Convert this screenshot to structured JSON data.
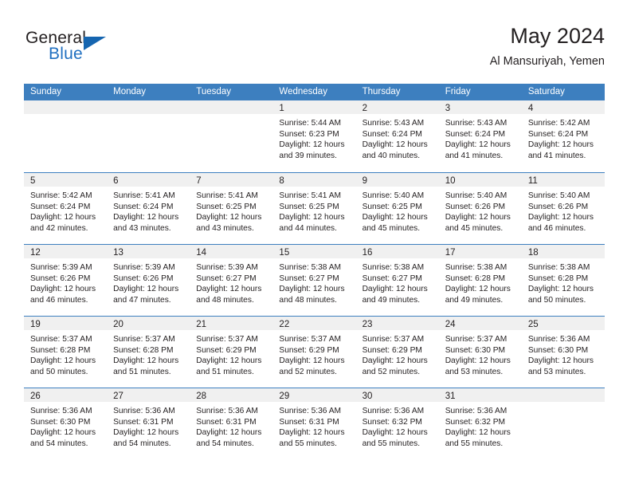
{
  "brand": {
    "name_top": "General",
    "name_bottom": "Blue",
    "accent_color": "#1565b0",
    "triangle_icon": "triangle-icon"
  },
  "header": {
    "title": "May 2024",
    "subtitle": "Al Mansuriyah, Yemen"
  },
  "theme": {
    "header_blue": "#3d7fbf",
    "day_band_gray": "#f0f0f0",
    "text": "#231f20"
  },
  "weekdays": [
    "Sunday",
    "Monday",
    "Tuesday",
    "Wednesday",
    "Thursday",
    "Friday",
    "Saturday"
  ],
  "weeks": [
    [
      {
        "day": "",
        "lines": []
      },
      {
        "day": "",
        "lines": []
      },
      {
        "day": "",
        "lines": []
      },
      {
        "day": "1",
        "lines": [
          "Sunrise: 5:44 AM",
          "Sunset: 6:23 PM",
          "Daylight: 12 hours",
          "and 39 minutes."
        ]
      },
      {
        "day": "2",
        "lines": [
          "Sunrise: 5:43 AM",
          "Sunset: 6:24 PM",
          "Daylight: 12 hours",
          "and 40 minutes."
        ]
      },
      {
        "day": "3",
        "lines": [
          "Sunrise: 5:43 AM",
          "Sunset: 6:24 PM",
          "Daylight: 12 hours",
          "and 41 minutes."
        ]
      },
      {
        "day": "4",
        "lines": [
          "Sunrise: 5:42 AM",
          "Sunset: 6:24 PM",
          "Daylight: 12 hours",
          "and 41 minutes."
        ]
      }
    ],
    [
      {
        "day": "5",
        "lines": [
          "Sunrise: 5:42 AM",
          "Sunset: 6:24 PM",
          "Daylight: 12 hours",
          "and 42 minutes."
        ]
      },
      {
        "day": "6",
        "lines": [
          "Sunrise: 5:41 AM",
          "Sunset: 6:24 PM",
          "Daylight: 12 hours",
          "and 43 minutes."
        ]
      },
      {
        "day": "7",
        "lines": [
          "Sunrise: 5:41 AM",
          "Sunset: 6:25 PM",
          "Daylight: 12 hours",
          "and 43 minutes."
        ]
      },
      {
        "day": "8",
        "lines": [
          "Sunrise: 5:41 AM",
          "Sunset: 6:25 PM",
          "Daylight: 12 hours",
          "and 44 minutes."
        ]
      },
      {
        "day": "9",
        "lines": [
          "Sunrise: 5:40 AM",
          "Sunset: 6:25 PM",
          "Daylight: 12 hours",
          "and 45 minutes."
        ]
      },
      {
        "day": "10",
        "lines": [
          "Sunrise: 5:40 AM",
          "Sunset: 6:26 PM",
          "Daylight: 12 hours",
          "and 45 minutes."
        ]
      },
      {
        "day": "11",
        "lines": [
          "Sunrise: 5:40 AM",
          "Sunset: 6:26 PM",
          "Daylight: 12 hours",
          "and 46 minutes."
        ]
      }
    ],
    [
      {
        "day": "12",
        "lines": [
          "Sunrise: 5:39 AM",
          "Sunset: 6:26 PM",
          "Daylight: 12 hours",
          "and 46 minutes."
        ]
      },
      {
        "day": "13",
        "lines": [
          "Sunrise: 5:39 AM",
          "Sunset: 6:26 PM",
          "Daylight: 12 hours",
          "and 47 minutes."
        ]
      },
      {
        "day": "14",
        "lines": [
          "Sunrise: 5:39 AM",
          "Sunset: 6:27 PM",
          "Daylight: 12 hours",
          "and 48 minutes."
        ]
      },
      {
        "day": "15",
        "lines": [
          "Sunrise: 5:38 AM",
          "Sunset: 6:27 PM",
          "Daylight: 12 hours",
          "and 48 minutes."
        ]
      },
      {
        "day": "16",
        "lines": [
          "Sunrise: 5:38 AM",
          "Sunset: 6:27 PM",
          "Daylight: 12 hours",
          "and 49 minutes."
        ]
      },
      {
        "day": "17",
        "lines": [
          "Sunrise: 5:38 AM",
          "Sunset: 6:28 PM",
          "Daylight: 12 hours",
          "and 49 minutes."
        ]
      },
      {
        "day": "18",
        "lines": [
          "Sunrise: 5:38 AM",
          "Sunset: 6:28 PM",
          "Daylight: 12 hours",
          "and 50 minutes."
        ]
      }
    ],
    [
      {
        "day": "19",
        "lines": [
          "Sunrise: 5:37 AM",
          "Sunset: 6:28 PM",
          "Daylight: 12 hours",
          "and 50 minutes."
        ]
      },
      {
        "day": "20",
        "lines": [
          "Sunrise: 5:37 AM",
          "Sunset: 6:28 PM",
          "Daylight: 12 hours",
          "and 51 minutes."
        ]
      },
      {
        "day": "21",
        "lines": [
          "Sunrise: 5:37 AM",
          "Sunset: 6:29 PM",
          "Daylight: 12 hours",
          "and 51 minutes."
        ]
      },
      {
        "day": "22",
        "lines": [
          "Sunrise: 5:37 AM",
          "Sunset: 6:29 PM",
          "Daylight: 12 hours",
          "and 52 minutes."
        ]
      },
      {
        "day": "23",
        "lines": [
          "Sunrise: 5:37 AM",
          "Sunset: 6:29 PM",
          "Daylight: 12 hours",
          "and 52 minutes."
        ]
      },
      {
        "day": "24",
        "lines": [
          "Sunrise: 5:37 AM",
          "Sunset: 6:30 PM",
          "Daylight: 12 hours",
          "and 53 minutes."
        ]
      },
      {
        "day": "25",
        "lines": [
          "Sunrise: 5:36 AM",
          "Sunset: 6:30 PM",
          "Daylight: 12 hours",
          "and 53 minutes."
        ]
      }
    ],
    [
      {
        "day": "26",
        "lines": [
          "Sunrise: 5:36 AM",
          "Sunset: 6:30 PM",
          "Daylight: 12 hours",
          "and 54 minutes."
        ]
      },
      {
        "day": "27",
        "lines": [
          "Sunrise: 5:36 AM",
          "Sunset: 6:31 PM",
          "Daylight: 12 hours",
          "and 54 minutes."
        ]
      },
      {
        "day": "28",
        "lines": [
          "Sunrise: 5:36 AM",
          "Sunset: 6:31 PM",
          "Daylight: 12 hours",
          "and 54 minutes."
        ]
      },
      {
        "day": "29",
        "lines": [
          "Sunrise: 5:36 AM",
          "Sunset: 6:31 PM",
          "Daylight: 12 hours",
          "and 55 minutes."
        ]
      },
      {
        "day": "30",
        "lines": [
          "Sunrise: 5:36 AM",
          "Sunset: 6:32 PM",
          "Daylight: 12 hours",
          "and 55 minutes."
        ]
      },
      {
        "day": "31",
        "lines": [
          "Sunrise: 5:36 AM",
          "Sunset: 6:32 PM",
          "Daylight: 12 hours",
          "and 55 minutes."
        ]
      },
      {
        "day": "",
        "lines": []
      }
    ]
  ]
}
